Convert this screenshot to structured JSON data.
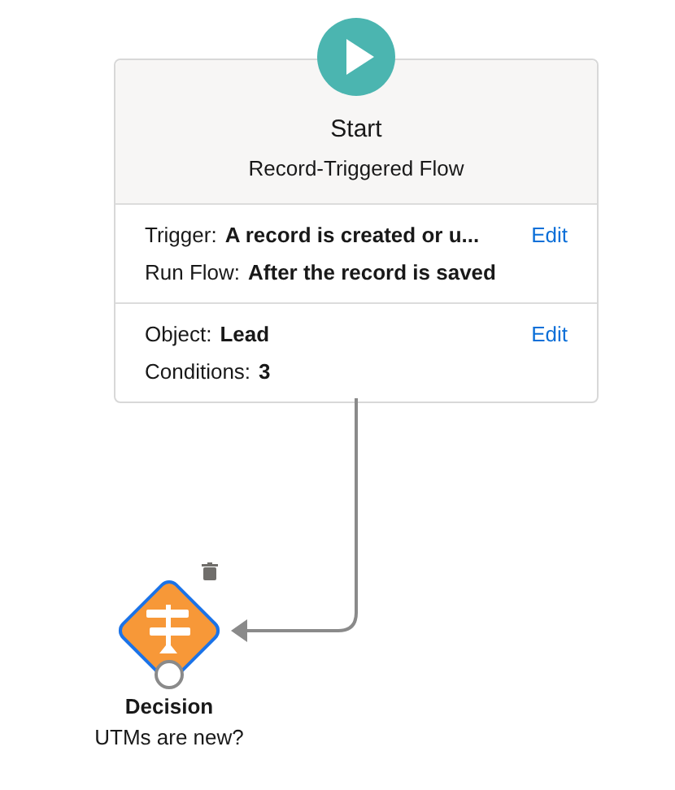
{
  "start": {
    "title": "Start",
    "subtitle": "Record-Triggered Flow",
    "sections": [
      {
        "rows": [
          {
            "label": "Trigger:",
            "value": "A record is created or u..."
          },
          {
            "label": "Run Flow:",
            "value": "After the record is saved"
          }
        ],
        "action": "Edit"
      },
      {
        "rows": [
          {
            "label": "Object:",
            "value": "Lead"
          },
          {
            "label": "Conditions:",
            "value": "3"
          }
        ],
        "action": "Edit"
      }
    ]
  },
  "decision": {
    "title": "Decision",
    "subtitle": "UTMs are new?",
    "selected": true
  }
}
